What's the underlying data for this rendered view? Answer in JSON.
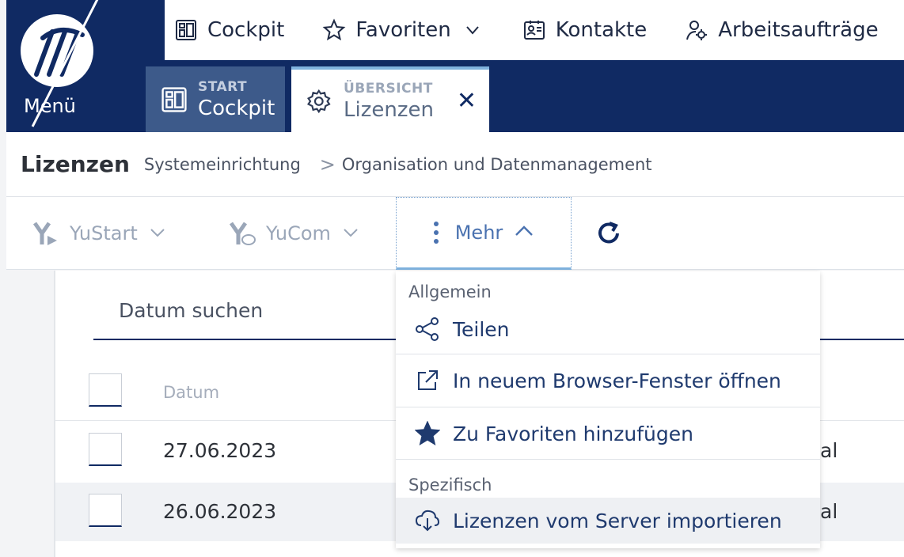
{
  "app": {
    "menu_label": "Menü"
  },
  "topnav": {
    "items": [
      {
        "label": "Cockpit",
        "icon": "cockpit-icon"
      },
      {
        "label": "Favoriten",
        "icon": "star-outline-icon",
        "has_chevron": true
      },
      {
        "label": "Kontakte",
        "icon": "contact-card-icon"
      },
      {
        "label": "Arbeitsaufträge",
        "icon": "worker-gear-icon"
      }
    ]
  },
  "tabs": [
    {
      "kicker": "START",
      "title": "Cockpit",
      "icon": "cockpit-icon",
      "active": false
    },
    {
      "kicker": "ÜBERSICHT",
      "title": "Lizenzen",
      "icon": "settings-gear-icon",
      "active": true,
      "close": "✕"
    }
  ],
  "breadcrumb": {
    "title": "Lizenzen",
    "items": [
      "Systemeinrichtung",
      "Organisation und Datenmanagement"
    ],
    "separator": ">"
  },
  "toolbar": {
    "yustart_label": "YuStart",
    "yucom_label": "YuCom",
    "mehr_label": "Mehr",
    "refresh_icon": "refresh-icon"
  },
  "search": {
    "placeholder": "Datum suchen"
  },
  "table": {
    "columns": [
      "Datum"
    ],
    "rows": [
      {
        "datum": "27.06.2023",
        "tail": "al"
      },
      {
        "datum": "26.06.2023",
        "tail": "al"
      }
    ]
  },
  "dropdown": {
    "section_general": "Allgemein",
    "section_specific": "Spezifisch",
    "items": [
      {
        "label": "Teilen",
        "icon": "share-icon"
      },
      {
        "label": "In neuem Browser-Fenster öffnen",
        "icon": "external-link-icon"
      },
      {
        "label": "Zu Favoriten hinzufügen",
        "icon": "star-filled-icon"
      },
      {
        "label": "Lizenzen vom Server importieren",
        "icon": "cloud-download-icon"
      }
    ]
  },
  "colors": {
    "navy": "#102a63",
    "tab_start_bg": "#3d5a8a",
    "accent_blue": "#7fb2de",
    "link_blue": "#4a72b0"
  }
}
